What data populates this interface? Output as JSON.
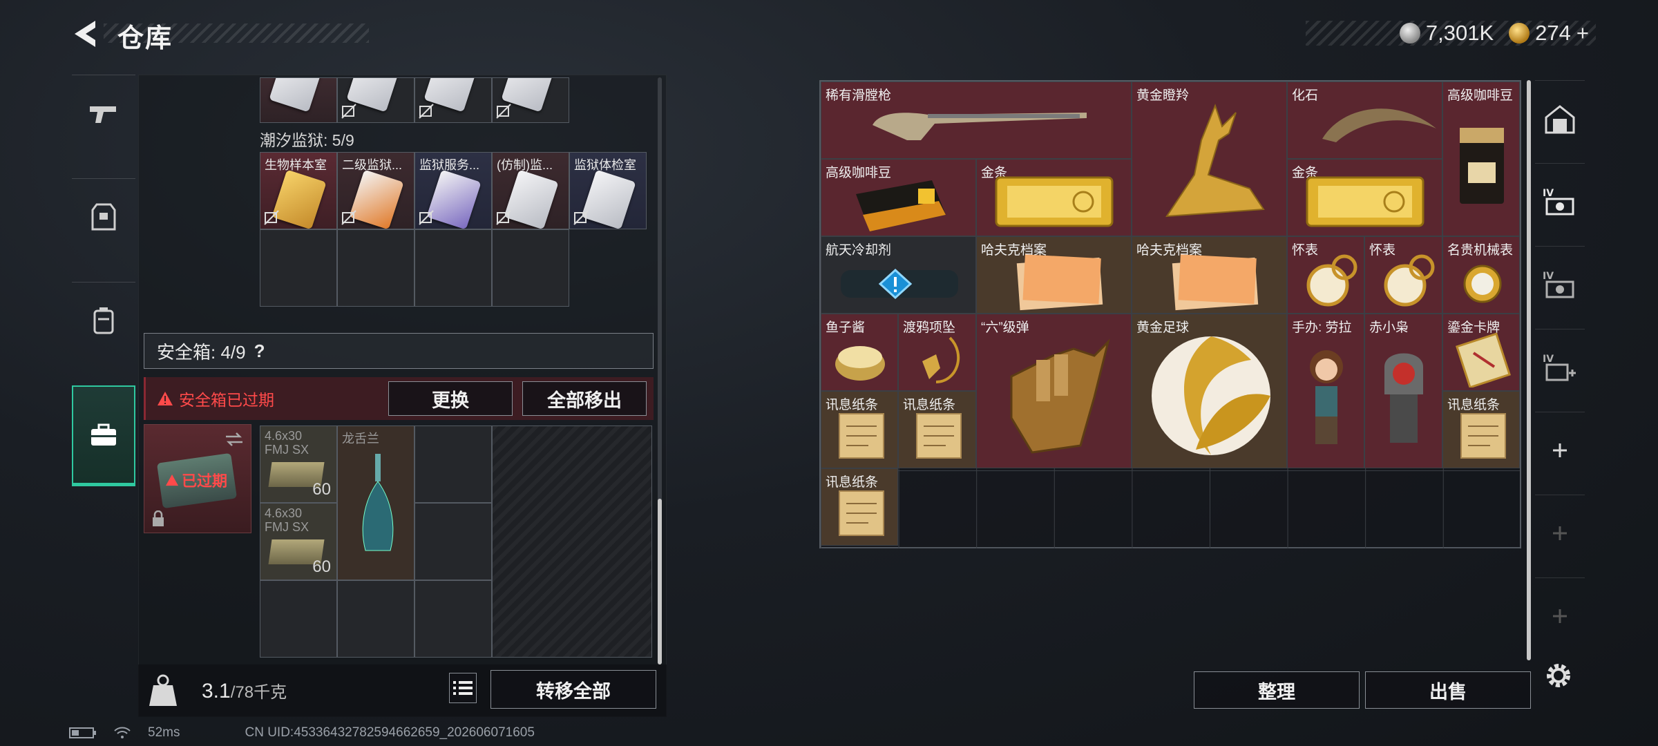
{
  "header": {
    "title": "仓库",
    "silver_amount": "7,301K",
    "gold_amount": "274",
    "gold_add": "+"
  },
  "left_panel": {
    "prison_label": "潮汐监狱: 5/9",
    "keycards": [
      "生物样本室",
      "二级监狱...",
      "监狱服务...",
      "(仿制)监...",
      "监狱体检室"
    ],
    "safebox": {
      "header": "安全箱: 4/9",
      "help": "?",
      "expired_warning": "安全箱已过期",
      "replace_button": "更换",
      "move_all_out_button": "全部移出",
      "expired_badge": "已过期",
      "items": [
        {
          "name": "4.6x30 FMJ SX",
          "qty": "60"
        },
        {
          "name": "龙舌兰",
          "qty": ""
        },
        {
          "name": "4.6x30 FMJ SX",
          "qty": "60"
        }
      ]
    },
    "weight": "3.1",
    "weight_total": "/78千克",
    "transfer_all_button": "转移全部"
  },
  "right_panel": {
    "items": [
      {
        "label": "稀有滑膛枪"
      },
      {
        "label": "黄金瞪羚"
      },
      {
        "label": "化石"
      },
      {
        "label": "高级咖啡豆"
      },
      {
        "label": "高级咖啡豆"
      },
      {
        "label": "金条"
      },
      {
        "label": "金条"
      },
      {
        "label": "航天冷却剂"
      },
      {
        "label": "哈夫克档案"
      },
      {
        "label": "哈夫克档案"
      },
      {
        "label": "怀表"
      },
      {
        "label": "怀表"
      },
      {
        "label": "名贵机械表"
      },
      {
        "label": "鱼子酱"
      },
      {
        "label": "渡鸦项坠"
      },
      {
        "label": "“六”级弹"
      },
      {
        "label": "黄金足球"
      },
      {
        "label": "手办: 劳拉"
      },
      {
        "label": "赤小枭"
      },
      {
        "label": "鎏金卡牌"
      },
      {
        "label": "讯息纸条"
      },
      {
        "label": "讯息纸条"
      },
      {
        "label": "讯息纸条"
      },
      {
        "label": "讯息纸条"
      }
    ],
    "sort_button": "整理",
    "sell_button": "出售"
  },
  "status": {
    "ping": "52ms",
    "uid": "CN UID:45336432782594662659_202606071605"
  },
  "colors": {
    "accent": "#2fc9a0",
    "warning": "#ff4a4a",
    "rare_red": "#5a262f"
  }
}
